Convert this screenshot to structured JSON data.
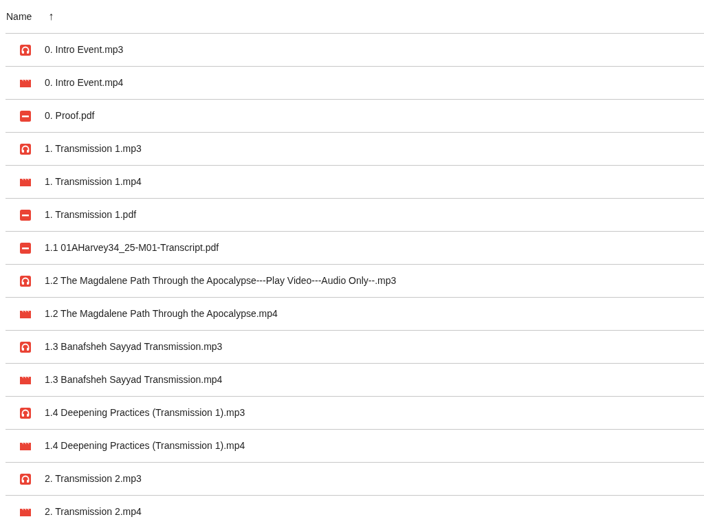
{
  "header": {
    "column": "Name",
    "sort_arrow": "↑"
  },
  "files": [
    {
      "kind": "audio",
      "name": "0. Intro Event.mp3"
    },
    {
      "kind": "video",
      "name": "0. Intro Event.mp4"
    },
    {
      "kind": "pdf",
      "name": "0. Proof.pdf"
    },
    {
      "kind": "audio",
      "name": "1. Transmission 1.mp3"
    },
    {
      "kind": "video",
      "name": "1. Transmission 1.mp4"
    },
    {
      "kind": "pdf",
      "name": "1. Transmission 1.pdf"
    },
    {
      "kind": "pdf",
      "name": "1.1 01AHarvey34_25-M01-Transcript.pdf"
    },
    {
      "kind": "audio",
      "name": "1.2 The Magdalene Path Through the Apocalypse---Play Video---Audio Only--.mp3"
    },
    {
      "kind": "video",
      "name": "1.2 The Magdalene Path Through the Apocalypse.mp4"
    },
    {
      "kind": "audio",
      "name": "1.3 Banafsheh Sayyad Transmission.mp3"
    },
    {
      "kind": "video",
      "name": "1.3 Banafsheh Sayyad Transmission.mp4"
    },
    {
      "kind": "audio",
      "name": "1.4 Deepening Practices (Transmission 1).mp3"
    },
    {
      "kind": "video",
      "name": "1.4 Deepening Practices (Transmission 1).mp4"
    },
    {
      "kind": "audio",
      "name": "2. Transmission 2.mp3"
    },
    {
      "kind": "video",
      "name": "2. Transmission 2.mp4"
    }
  ]
}
